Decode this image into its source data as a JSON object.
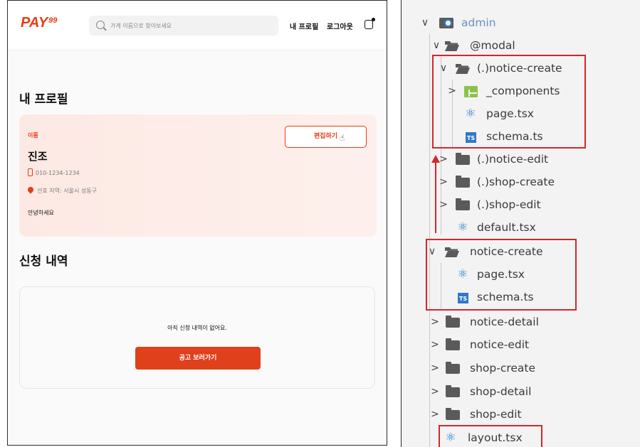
{
  "app": {
    "logo": {
      "main": "PAY",
      "sup": "99"
    },
    "search": {
      "placeholder": "가게 이름으로 찾아보세요"
    },
    "nav": {
      "profile": "내 프로필",
      "logout": "로그아웃"
    },
    "page_title": "내 프로필",
    "profile": {
      "name_label": "이름",
      "name": "진조",
      "phone": "010-1234-1234",
      "area": "선호 지역: 서울시 성동구",
      "intro": "안녕하세요",
      "edit_button": "편집하기"
    },
    "applications": {
      "title": "신청 내역",
      "empty_text": "아직 신청 내역이 없어요.",
      "button": "공고 보러가기"
    },
    "colors": {
      "accent": "#ea3c12",
      "button": "#e0401b",
      "card_bg": "#fde9e4"
    }
  },
  "explorer": {
    "items": [
      {
        "label": "admin",
        "kind": "folder-root",
        "state": "expanded"
      },
      {
        "label": "@modal",
        "kind": "folder",
        "state": "expanded"
      },
      {
        "label": "(.)notice-create",
        "kind": "folder",
        "state": "expanded"
      },
      {
        "label": "_components",
        "kind": "components-folder",
        "state": "collapsed"
      },
      {
        "label": "page.tsx",
        "kind": "react-file"
      },
      {
        "label": "schema.ts",
        "kind": "ts-file"
      },
      {
        "label": "(.)notice-edit",
        "kind": "folder",
        "state": "collapsed"
      },
      {
        "label": "(.)shop-create",
        "kind": "folder",
        "state": "collapsed"
      },
      {
        "label": "(.)shop-edit",
        "kind": "folder",
        "state": "collapsed"
      },
      {
        "label": "default.tsx",
        "kind": "react-file"
      },
      {
        "label": "notice-create",
        "kind": "folder",
        "state": "expanded"
      },
      {
        "label": "page.tsx",
        "kind": "react-file"
      },
      {
        "label": "schema.ts",
        "kind": "ts-file"
      },
      {
        "label": "notice-detail",
        "kind": "folder",
        "state": "collapsed"
      },
      {
        "label": "notice-edit",
        "kind": "folder",
        "state": "collapsed"
      },
      {
        "label": "shop-create",
        "kind": "folder",
        "state": "collapsed"
      },
      {
        "label": "shop-detail",
        "kind": "folder",
        "state": "collapsed"
      },
      {
        "label": "shop-edit",
        "kind": "folder",
        "state": "collapsed"
      },
      {
        "label": "layout.tsx",
        "kind": "react-file"
      }
    ],
    "ts_badge": "TS",
    "chevron_expanded": "∨",
    "chevron_collapsed": ">",
    "react_glyph": "⚛",
    "colors": {
      "annotation": "#d5262c",
      "ts": "#3178c6",
      "react": "#1b7fce"
    }
  }
}
